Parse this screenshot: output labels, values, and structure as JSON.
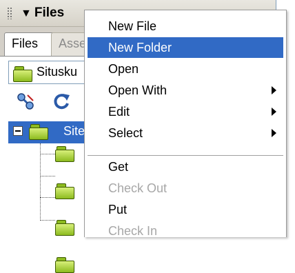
{
  "panel": {
    "title": "Files",
    "collapse_glyph": "▼",
    "tabs": [
      {
        "label": "Files",
        "active": true
      },
      {
        "label": "Asse",
        "active": false
      }
    ],
    "site_select": {
      "value": "Situsku",
      "icon": "folder-icon"
    },
    "toolbar": [
      {
        "name": "connect-icon"
      },
      {
        "name": "refresh-icon"
      }
    ],
    "tree": {
      "root_label": "Site",
      "expander": "−",
      "children_count_shown": 4
    }
  },
  "context_menu": {
    "items": [
      {
        "label": "New File",
        "state": "normal",
        "submenu": false
      },
      {
        "label": "New Folder",
        "state": "highlighted",
        "submenu": false
      },
      {
        "label": "Open",
        "state": "normal",
        "submenu": false
      },
      {
        "label": "Open With",
        "state": "normal",
        "submenu": true
      },
      {
        "label": "Edit",
        "state": "normal",
        "submenu": true
      },
      {
        "label": "Select",
        "state": "normal",
        "submenu": true
      },
      {
        "label": "Get",
        "state": "normal",
        "submenu": false
      },
      {
        "label": "Check Out",
        "state": "disabled",
        "submenu": false
      },
      {
        "label": "Put",
        "state": "normal",
        "submenu": false
      },
      {
        "label": "Check In",
        "state": "disabled",
        "submenu": false
      }
    ]
  },
  "colors": {
    "highlight": "#316ac5",
    "disabled_text": "#a7a7a7",
    "folder_green": "#8dbb1f"
  }
}
